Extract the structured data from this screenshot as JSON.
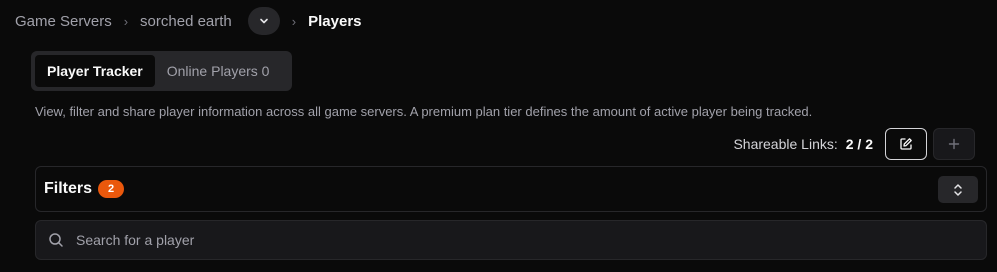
{
  "breadcrumb": {
    "items": [
      "Game Servers",
      "sorched earth"
    ],
    "current": "Players",
    "separator": "›"
  },
  "tabs": [
    {
      "label": "Player Tracker",
      "active": true
    },
    {
      "label": "Online Players 0",
      "active": false
    }
  ],
  "description": "View, filter and share player information across all game servers. A premium plan tier defines the amount of active player being tracked.",
  "share": {
    "label": "Shareable Links:",
    "count": "2 / 2"
  },
  "filters": {
    "title": "Filters",
    "badge": "2"
  },
  "search": {
    "placeholder": "Search for a player",
    "value": ""
  },
  "colors": {
    "background": "#0a0a0a",
    "accent_badge": "#ea580c"
  },
  "icons": [
    "chevron-down-icon",
    "edit-icon",
    "plus-icon",
    "chevrons-up-down-icon",
    "search-icon"
  ]
}
